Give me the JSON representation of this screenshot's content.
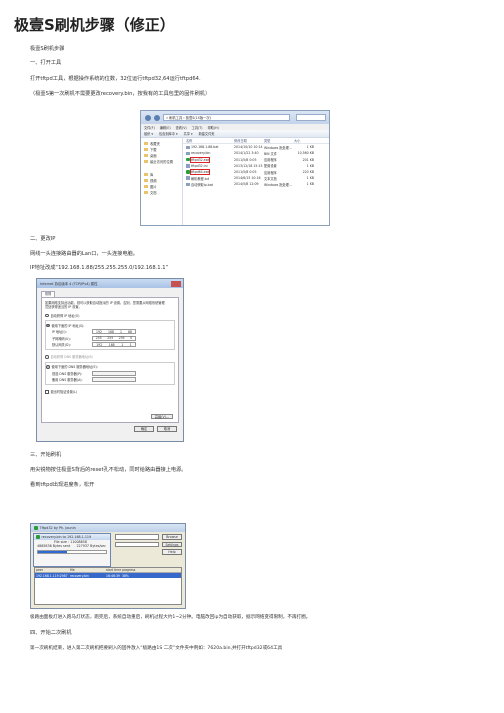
{
  "doc": {
    "title": "极壹S刷机步骤（修正）",
    "p1": "极壹S刷机步骤",
    "h1": "一、打开工具",
    "p2": "打开tftpd工具，根据操作系统的位数，32位运行tftpd32,64运行tftpd64.",
    "p3": "（极壹S第一次刷机不需要更改recovery.bin，按我有的工具包里的固件刷机）",
    "h2": "二、更改IP",
    "p4": "网线一头连接路由器的Lan口，一头连接电脑。",
    "p5": "IP地址改成“192.168.1.88/255.255.255.0/192.168.1.1”",
    "h3": "三、开始刷机",
    "p6": "用尖锐物按住极壹S背后的reset孔不松动，同时给路由器接上电源。",
    "p7": "看到tftpd出现进度条，松开",
    "p8": "极路由面板灯进入跑马灯状态，跑完后，系统自动重启，刷机过程大约1~2分钟。电脑改回ip为自动获取，据示网络变得限制，不再打圈。",
    "h4": "四、开始二次刷机",
    "p9": "第一次刷机结束，进入第二次刷机把要刷入的固件放入“极路由1S 二次”文件夹中例如：7620a.bin,并打开tftpd32或64工具"
  },
  "explorer": {
    "address": "« 刷机工具 › 极壹S(1S版一次)",
    "menu": [
      "文件(F)",
      "编辑(E)",
      "查看(V)",
      "工具(T)",
      "帮助(H)"
    ],
    "toolbar": [
      "组织 ▾",
      "包含到库中 ▾",
      "共享 ▾",
      "新建文件夹"
    ],
    "sidebar": [
      "收藏夹",
      "下载",
      "桌面",
      "最近访问的位置",
      "",
      "库",
      "视频",
      "图片",
      "文档"
    ],
    "columns": [
      "名称",
      "修改日期",
      "类型",
      "大小"
    ],
    "files": [
      {
        "name": "192.168.1.88.bat",
        "date": "2014/10/10 10:14",
        "type": "Windows 批处理...",
        "size": "1 KB",
        "hl": false
      },
      {
        "name": "recovery.bin",
        "date": "2014/1/22 3:40",
        "type": "BIN 文件",
        "size": "10,560 KB",
        "hl": false
      },
      {
        "name": "tftpd32.exe",
        "date": "2011/5/8 0:05",
        "type": "应用程序",
        "size": "201 KB",
        "hl": true
      },
      {
        "name": "tftpd32.ini",
        "date": "2013/12/18 15:15",
        "type": "配置设置",
        "size": "1 KB",
        "hl": false
      },
      {
        "name": "tftpd64.exe",
        "date": "2011/5/8 0:05",
        "type": "应用程序",
        "size": "220 KB",
        "hl": true
      },
      {
        "name": "刷机教程.txt",
        "date": "2014/6/15 10:16",
        "type": "文本文档",
        "size": "1 KB",
        "hl": false
      },
      {
        "name": "自动获取ip.bat",
        "date": "2014/5/8 12:09",
        "type": "Windows 批处理...",
        "size": "1 KB",
        "hl": false
      }
    ]
  },
  "dialog": {
    "title": "Internet 协议版本 4 (TCP/IPv4) 属性",
    "tab": "常规",
    "desc": "如果网络支持此功能，则可以获取自动指派的 IP 设置。否则，您需要从网络系统管理员处获得适当的 IP 设置。",
    "auto_ip": "自动获得 IP 地址(O)",
    "manual_ip": "使用下面的 IP 地址(S):",
    "ip_label": "IP 地址(I):",
    "ip": [
      "192",
      "168",
      "1",
      "88"
    ],
    "mask_label": "子网掩码(U):",
    "mask": [
      "255",
      "255",
      "255",
      "0"
    ],
    "gw_label": "默认网关(D):",
    "gw": [
      "192",
      "168",
      "1",
      "1"
    ],
    "auto_dns": "自动获得 DNS 服务器地址(B)",
    "manual_dns": "使用下面的 DNS 服务器地址(E):",
    "dns1": "首选 DNS 服务器(P):",
    "dns2": "备用 DNS 服务器(A):",
    "validate": "退出时验证设置(L)",
    "advanced": "高级(V)...",
    "ok": "确定",
    "cancel": "取消"
  },
  "tftp": {
    "title": "Tftpd32 by Ph. Jounin",
    "popup_title": "recovery.bin to 192.168.1.119",
    "file_size": "File size : 11008658",
    "bytes_sent": "4865836 Bytes sent",
    "rate": "227937 Bytes/sec",
    "progress": 0.42,
    "browse": "Browse",
    "settings": "Settings",
    "help": "Help",
    "columns": [
      "peer",
      "file",
      "start time",
      "progress",
      ""
    ],
    "row": [
      "192.168.1.119:2987",
      "recovery.bin",
      "16:46:39",
      "38%",
      ""
    ]
  }
}
